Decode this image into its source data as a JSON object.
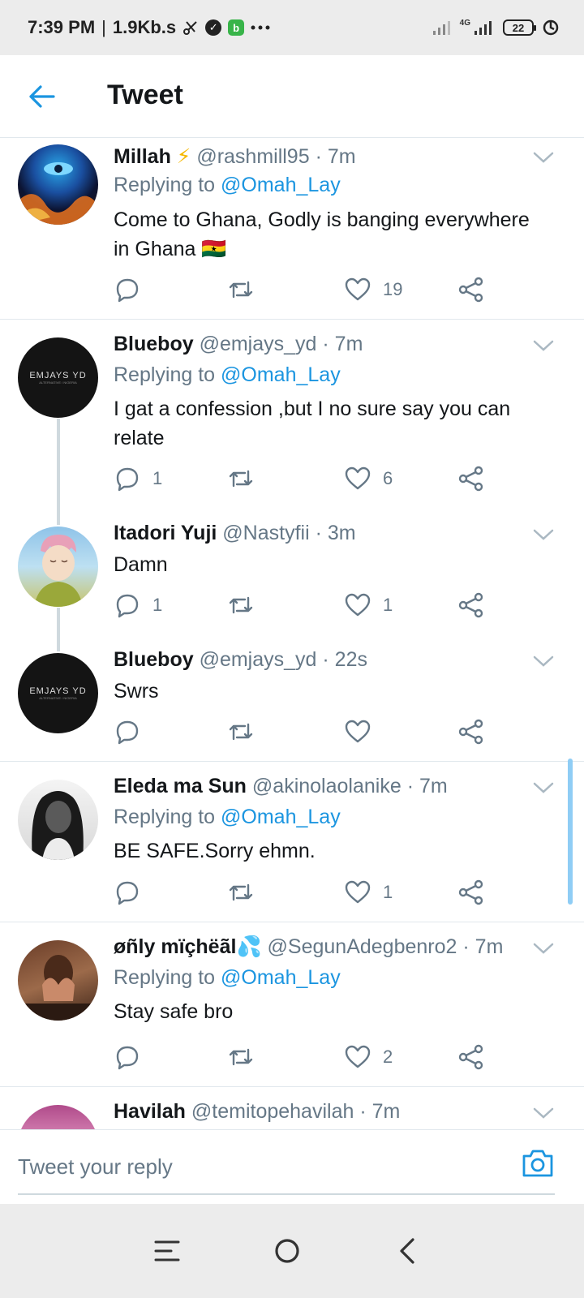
{
  "status_bar": {
    "time": "7:39 PM",
    "separator": "|",
    "speed": "1.9Kb.s",
    "network_label": "4G",
    "battery": "22",
    "icons": [
      "scissors-icon",
      "check-circle-icon",
      "app-notification-icon",
      "more-dots-icon",
      "signal-icon",
      "battery-icon",
      "data-saver-icon"
    ]
  },
  "header": {
    "title": "Tweet",
    "back_icon": "arrow-left-icon",
    "accent_color": "#1b95e0"
  },
  "tweets": [
    {
      "name": "Millah",
      "emoji": "⚡",
      "handle": "@rashmill95",
      "time": "· 7m",
      "replying_prefix": "Replying to",
      "replying_to": "@Omah_Lay",
      "text_lines": [
        "Come to Ghana, Godly is banging everywhere",
        "in Ghana 🇬🇭"
      ],
      "replies": "",
      "likes": "19"
    },
    {
      "name": "Blueboy",
      "handle": "@emjays_yd",
      "time": "· 7m",
      "replying_prefix": "Replying to",
      "replying_to": "@Omah_Lay",
      "text_lines": [
        "I gat a confession ,but I no sure say you can",
        "relate"
      ],
      "replies": "1",
      "likes": "6",
      "avatar_text": "EMJAYS YD",
      "avatar_subtext": "ALTERNATIVE / NIGERIA"
    },
    {
      "name": "Itadori Yuji",
      "handle": "@Nastyfii",
      "time": "· 3m",
      "text_lines": [
        "Damn"
      ],
      "replies": "1",
      "likes": "1"
    },
    {
      "name": "Blueboy",
      "handle": "@emjays_yd",
      "time": "· 22s",
      "text_lines": [
        "Swrs"
      ],
      "replies": "",
      "likes": "",
      "avatar_text": "EMJAYS YD",
      "avatar_subtext": "ALTERNATIVE / NIGERIA"
    },
    {
      "name": "Eleda ma Sun",
      "handle": "@akinolaolanike",
      "time": "· 7m",
      "replying_prefix": "Replying to",
      "replying_to": "@Omah_Lay",
      "text_lines": [
        "BE SAFE.Sorry ehmn."
      ],
      "replies": "",
      "likes": "1"
    },
    {
      "name": "øñly mïçhëãl💦",
      "handle": "@SegunAdegbenro2",
      "time": "· 7m",
      "replying_prefix": "Replying to",
      "replying_to": "@Omah_Lay",
      "text_lines": [
        "Stay safe bro"
      ],
      "replies": "",
      "likes": "2"
    },
    {
      "name": "Havilah",
      "handle": "@temitopehavilah",
      "time": "· 7m"
    }
  ],
  "reply_bar": {
    "placeholder": "Tweet your reply",
    "camera_icon": "camera-icon"
  },
  "nav_bar": {
    "icons": [
      "menu-icon",
      "home-circle-icon",
      "back-chevron-icon"
    ]
  }
}
